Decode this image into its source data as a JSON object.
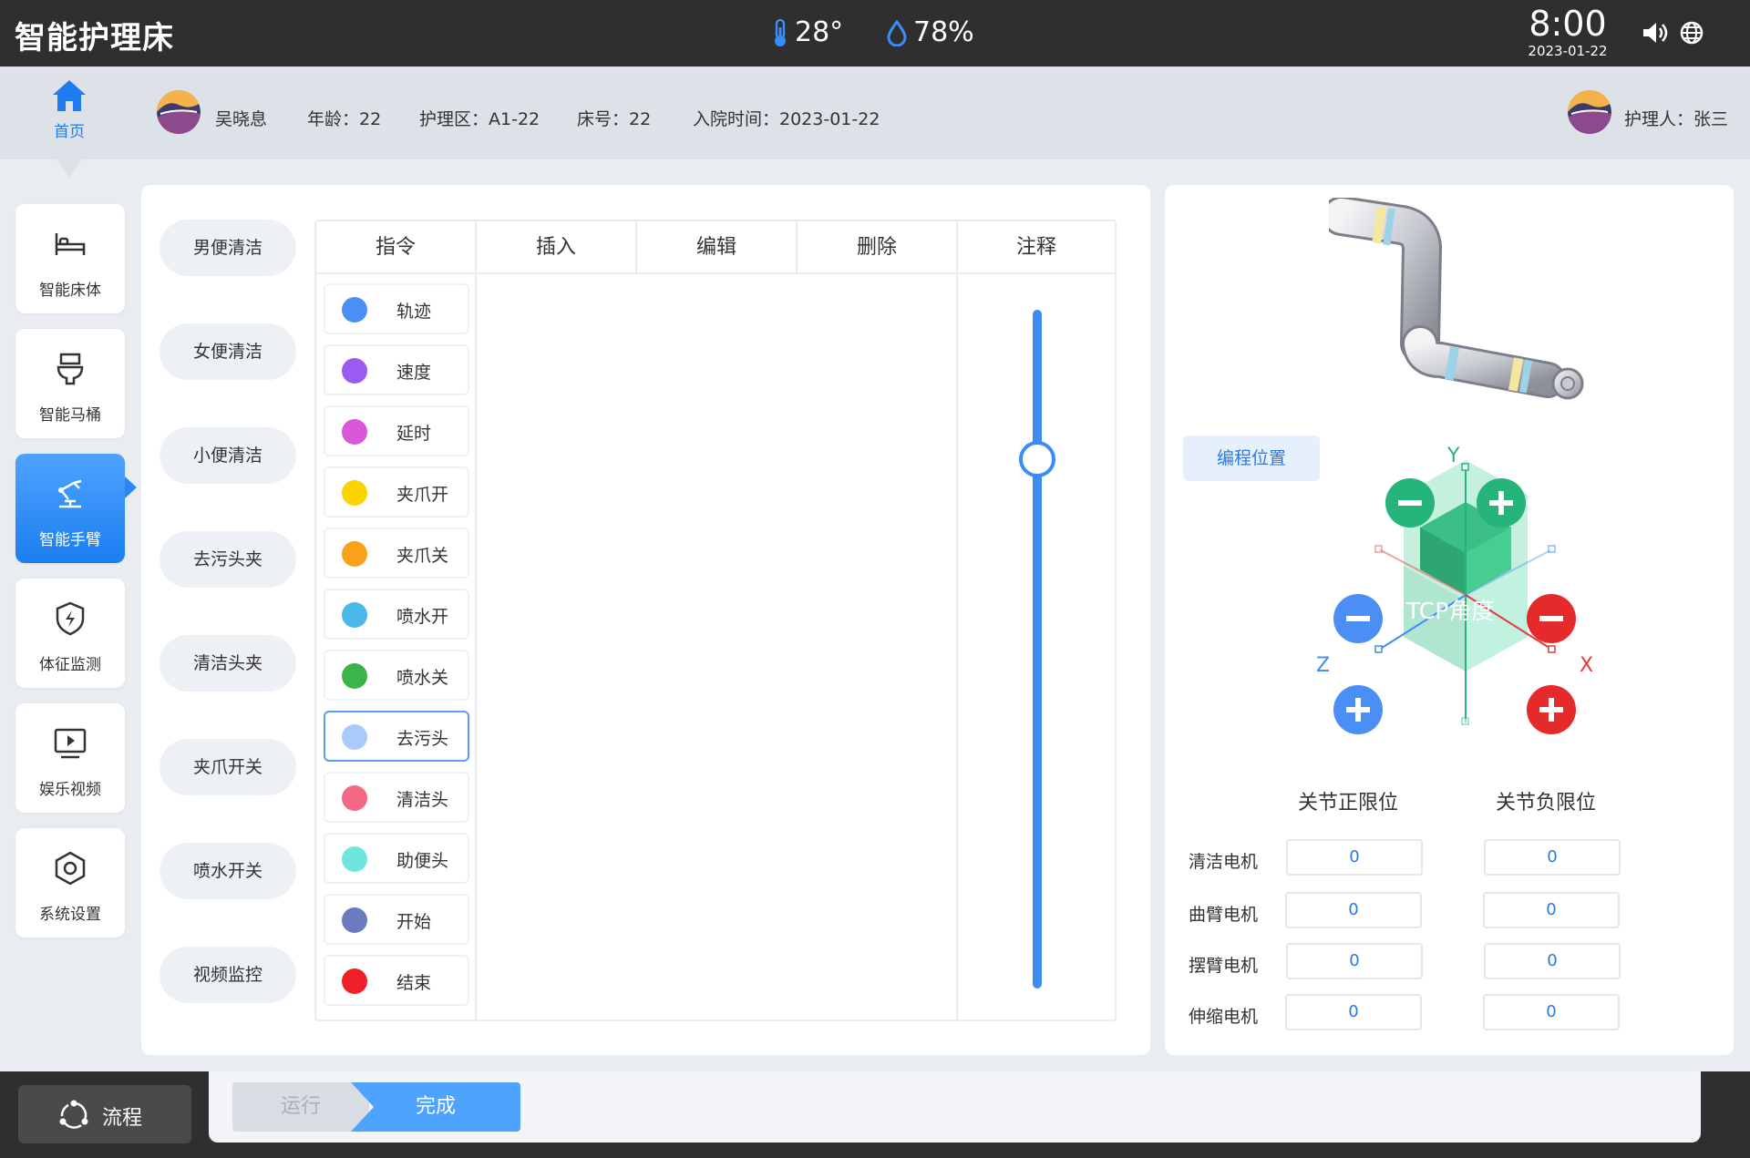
{
  "app": {
    "title": "智能护理床"
  },
  "status": {
    "temperature": "28°",
    "humidity": "78%",
    "time": "8:00",
    "date": "2023-01-22"
  },
  "home": {
    "label": "首页"
  },
  "patient": {
    "name": "吴晓息",
    "age": "年龄：22",
    "ward": "护理区：A1-22",
    "bed": "床号：22",
    "admitted": "入院时间：2023-01-22",
    "caregiver": "护理人：张三"
  },
  "sidebar": {
    "items": [
      {
        "label": "智能床体",
        "icon": "bed-icon"
      },
      {
        "label": "智能马桶",
        "icon": "toilet-icon"
      },
      {
        "label": "智能手臂",
        "icon": "robot-arm-icon",
        "active": true
      },
      {
        "label": "体征监测",
        "icon": "shield-bolt-icon"
      },
      {
        "label": "娱乐视频",
        "icon": "video-play-icon"
      },
      {
        "label": "系统设置",
        "icon": "settings-hex-icon"
      }
    ]
  },
  "modes": [
    "男便清洁",
    "女便清洁",
    "小便清洁",
    "去污头夹",
    "清洁头夹",
    "夹爪开关",
    "喷水开关",
    "视频监控"
  ],
  "table": {
    "headers": [
      "指令",
      "插入",
      "编辑",
      "删除",
      "注释"
    ]
  },
  "commands": [
    {
      "label": "轨迹",
      "color": "#4b8ff5"
    },
    {
      "label": "速度",
      "color": "#9a5cf0"
    },
    {
      "label": "延时",
      "color": "#d957d8"
    },
    {
      "label": "夹爪开",
      "color": "#fbd300"
    },
    {
      "label": "夹爪关",
      "color": "#f7a21b"
    },
    {
      "label": "喷水开",
      "color": "#4bb8ea"
    },
    {
      "label": "喷水关",
      "color": "#3bb54a"
    },
    {
      "label": "去污头",
      "color": "#a9cbfa",
      "selected": true
    },
    {
      "label": "清洁头",
      "color": "#f46a86"
    },
    {
      "label": "助便头",
      "color": "#6ee6dc"
    },
    {
      "label": "开始",
      "color": "#6a7bc0"
    },
    {
      "label": "结束",
      "color": "#ee2129"
    }
  ],
  "slider": {
    "value": 0.22
  },
  "right": {
    "program_position": "编程位置",
    "tcp_label": "TCP角度",
    "axes": {
      "x": "X",
      "y": "Y",
      "z": "Z"
    },
    "limits_pos_header": "关节正限位",
    "limits_neg_header": "关节负限位",
    "motors": [
      {
        "name": "清洁电机",
        "pos": "0",
        "neg": "0"
      },
      {
        "name": "曲臂电机",
        "pos": "0",
        "neg": "0"
      },
      {
        "name": "摆臂电机",
        "pos": "0",
        "neg": "0"
      },
      {
        "name": "伸缩电机",
        "pos": "0",
        "neg": "0"
      }
    ]
  },
  "bottom": {
    "flow": "流程",
    "run": "运行",
    "done": "完成"
  }
}
